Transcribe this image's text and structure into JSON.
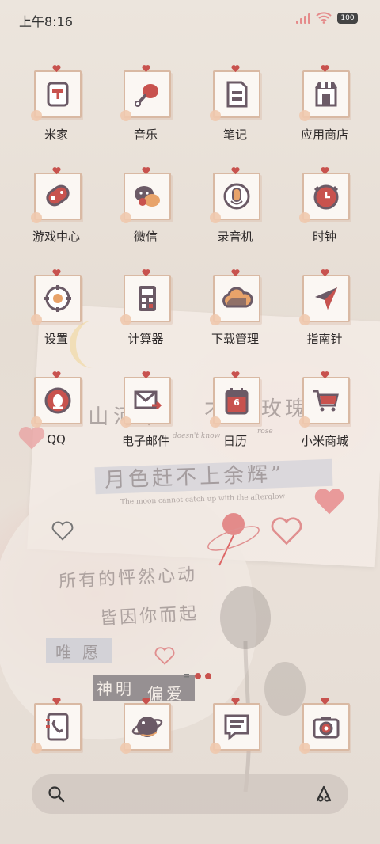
{
  "status": {
    "time": "上午8:16",
    "battery": "100"
  },
  "apps": [
    {
      "label": "米家",
      "icon": "mijia-icon"
    },
    {
      "label": "音乐",
      "icon": "music-icon"
    },
    {
      "label": "笔记",
      "icon": "notes-icon"
    },
    {
      "label": "应用商店",
      "icon": "app-store-icon"
    },
    {
      "label": "游戏中心",
      "icon": "game-center-icon"
    },
    {
      "label": "微信",
      "icon": "wechat-icon"
    },
    {
      "label": "录音机",
      "icon": "recorder-icon"
    },
    {
      "label": "时钟",
      "icon": "clock-icon"
    },
    {
      "label": "设置",
      "icon": "settings-icon"
    },
    {
      "label": "计算器",
      "icon": "calculator-icon"
    },
    {
      "label": "下载管理",
      "icon": "downloads-icon"
    },
    {
      "label": "指南针",
      "icon": "compass-icon"
    },
    {
      "label": "QQ",
      "icon": "qq-icon"
    },
    {
      "label": "电子邮件",
      "icon": "email-icon"
    },
    {
      "label": "日历",
      "icon": "calendar-icon"
    },
    {
      "label": "小米商城",
      "icon": "mi-store-icon"
    }
  ],
  "calendar_day": "6",
  "dock": [
    {
      "icon": "contacts-phone-icon"
    },
    {
      "icon": "browser-icon"
    },
    {
      "icon": "messages-icon"
    },
    {
      "icon": "camera-icon"
    }
  ],
  "wallpaper": {
    "line1": "“山河不",
    "line1b": "不",
    "line1c": "玫瑰",
    "line1_en": "doesn't know",
    "line1_en2": "rose",
    "line2": "月色赶不上余辉”",
    "line2_en": "The moon cannot catch up with the afterglow",
    "line3": "所有的怦然心动",
    "line4": "皆因你而起",
    "tag1": "唯愿",
    "tag2a": "神明",
    "tag2b": "偏爱"
  },
  "colors": {
    "accent": "#c8524e",
    "tile_border": "#d9b9a3",
    "icon_fill": "#6b5a66"
  }
}
